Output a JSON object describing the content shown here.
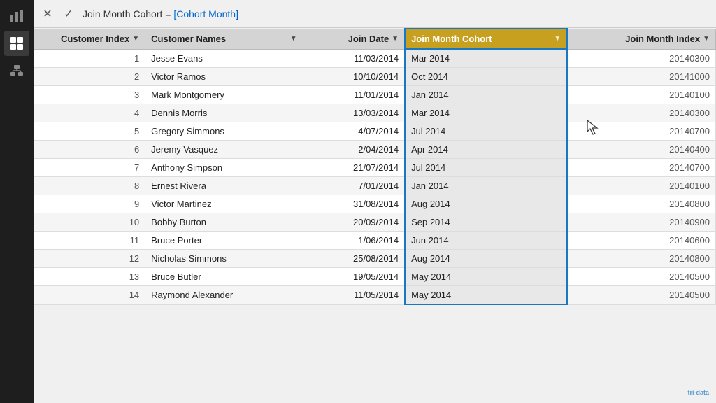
{
  "sidebar": {
    "icons": [
      {
        "name": "bar-chart-icon",
        "symbol": "📊",
        "active": false
      },
      {
        "name": "grid-icon",
        "symbol": "⊞",
        "active": true
      },
      {
        "name": "hierarchy-icon",
        "symbol": "⊟",
        "active": false
      }
    ]
  },
  "formula_bar": {
    "cancel_label": "✕",
    "confirm_label": "✓",
    "formula": "Join Month Cohort = [Cohort Month]",
    "formula_plain": "Join Month Cohort = ",
    "formula_highlighted": "[Cohort Month]"
  },
  "table": {
    "columns": [
      {
        "label": "Customer Index",
        "key": "customer_index"
      },
      {
        "label": "Customer Names",
        "key": "customer_names"
      },
      {
        "label": "Join Date",
        "key": "join_date"
      },
      {
        "label": "Join Month Cohort",
        "key": "join_month_cohort"
      },
      {
        "label": "Join Month Index",
        "key": "join_month_index"
      }
    ],
    "rows": [
      {
        "customer_index": 1,
        "customer_names": "Jesse Evans",
        "join_date": "11/03/2014",
        "join_month_cohort": "Mar 2014",
        "join_month_index": 20140300
      },
      {
        "customer_index": 2,
        "customer_names": "Victor Ramos",
        "join_date": "10/10/2014",
        "join_month_cohort": "Oct 2014",
        "join_month_index": 20141000
      },
      {
        "customer_index": 3,
        "customer_names": "Mark Montgomery",
        "join_date": "11/01/2014",
        "join_month_cohort": "Jan 2014",
        "join_month_index": 20140100
      },
      {
        "customer_index": 4,
        "customer_names": "Dennis Morris",
        "join_date": "13/03/2014",
        "join_month_cohort": "Mar 2014",
        "join_month_index": 20140300
      },
      {
        "customer_index": 5,
        "customer_names": "Gregory Simmons",
        "join_date": "4/07/2014",
        "join_month_cohort": "Jul 2014",
        "join_month_index": 20140700
      },
      {
        "customer_index": 6,
        "customer_names": "Jeremy Vasquez",
        "join_date": "2/04/2014",
        "join_month_cohort": "Apr 2014",
        "join_month_index": 20140400
      },
      {
        "customer_index": 7,
        "customer_names": "Anthony Simpson",
        "join_date": "21/07/2014",
        "join_month_cohort": "Jul 2014",
        "join_month_index": 20140700
      },
      {
        "customer_index": 8,
        "customer_names": "Ernest Rivera",
        "join_date": "7/01/2014",
        "join_month_cohort": "Jan 2014",
        "join_month_index": 20140100
      },
      {
        "customer_index": 9,
        "customer_names": "Victor Martinez",
        "join_date": "31/08/2014",
        "join_month_cohort": "Aug 2014",
        "join_month_index": 20140800
      },
      {
        "customer_index": 10,
        "customer_names": "Bobby Burton",
        "join_date": "20/09/2014",
        "join_month_cohort": "Sep 2014",
        "join_month_index": 20140900
      },
      {
        "customer_index": 11,
        "customer_names": "Bruce Porter",
        "join_date": "1/06/2014",
        "join_month_cohort": "Jun 2014",
        "join_month_index": 20140600
      },
      {
        "customer_index": 12,
        "customer_names": "Nicholas Simmons",
        "join_date": "25/08/2014",
        "join_month_cohort": "Aug 2014",
        "join_month_index": 20140800
      },
      {
        "customer_index": 13,
        "customer_names": "Bruce Butler",
        "join_date": "19/05/2014",
        "join_month_cohort": "May 2014",
        "join_month_index": 20140500
      },
      {
        "customer_index": 14,
        "customer_names": "Raymond Alexander",
        "join_date": "11/05/2014",
        "join_month_cohort": "May 2014",
        "join_month_index": 20140500
      }
    ]
  },
  "watermark": "tri-data"
}
